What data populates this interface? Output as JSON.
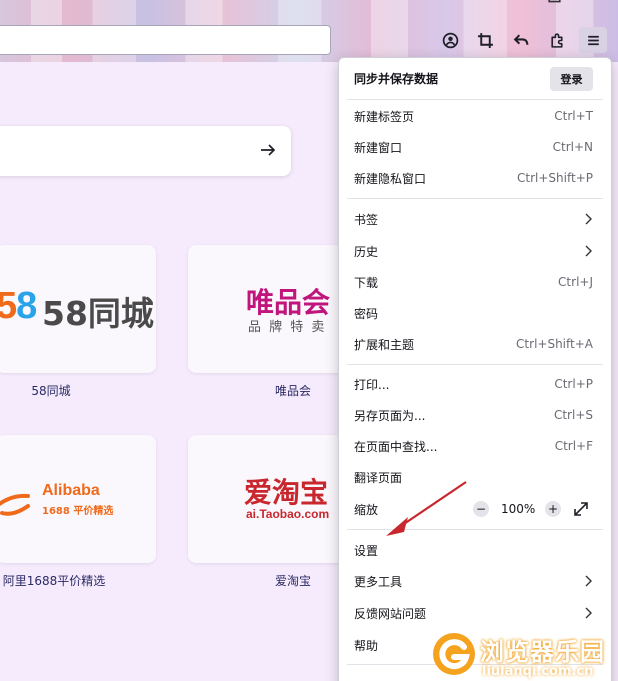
{
  "toolbar": {
    "icons": [
      "account-icon",
      "screenshot-icon",
      "back-arrow-icon",
      "extensions-icon",
      "menu-icon"
    ]
  },
  "newtab": {
    "shortcuts": [
      {
        "label": "58同城",
        "logo_text": "58同城"
      },
      {
        "label": "唯品会",
        "logo_text": "唯品会",
        "logo_sub": "品 牌 特 卖"
      },
      {
        "label": "阿里1688平价精选",
        "logo_text": "Alibaba",
        "logo_sub": "1688 平价精选"
      },
      {
        "label": "爱淘宝",
        "logo_text": "爱淘宝",
        "logo_sub": "ai.Taobao.com"
      }
    ]
  },
  "menu": {
    "sync_title": "同步并保存数据",
    "login_label": "登录",
    "items": [
      {
        "label": "新建标签页",
        "shortcut": "Ctrl+T"
      },
      {
        "label": "新建窗口",
        "shortcut": "Ctrl+N"
      },
      {
        "label": "新建隐私窗口",
        "shortcut": "Ctrl+Shift+P"
      },
      {
        "label": "书签",
        "shortcut": ""
      },
      {
        "label": "历史",
        "shortcut": ""
      },
      {
        "label": "下载",
        "shortcut": "Ctrl+J"
      },
      {
        "label": "密码",
        "shortcut": ""
      },
      {
        "label": "扩展和主题",
        "shortcut": "Ctrl+Shift+A"
      },
      {
        "label": "打印...",
        "shortcut": "Ctrl+P"
      },
      {
        "label": "另存页面为...",
        "shortcut": "Ctrl+S"
      },
      {
        "label": "在页面中查找...",
        "shortcut": "Ctrl+F"
      },
      {
        "label": "翻译页面",
        "shortcut": ""
      },
      {
        "label": "缩放",
        "shortcut": ""
      },
      {
        "label": "设置",
        "shortcut": ""
      },
      {
        "label": "更多工具",
        "shortcut": ""
      },
      {
        "label": "反馈网站问题",
        "shortcut": ""
      },
      {
        "label": "帮助",
        "shortcut": ""
      }
    ],
    "zoom": {
      "minus": "−",
      "value": "100%",
      "plus": "+"
    }
  },
  "watermark": {
    "title": "浏览器乐园",
    "url": "liulanqi.com.cn"
  },
  "colors": {
    "accent_red": "#c8282d",
    "vip_magenta": "#c0157d",
    "alibaba_orange": "#f06a1c"
  }
}
